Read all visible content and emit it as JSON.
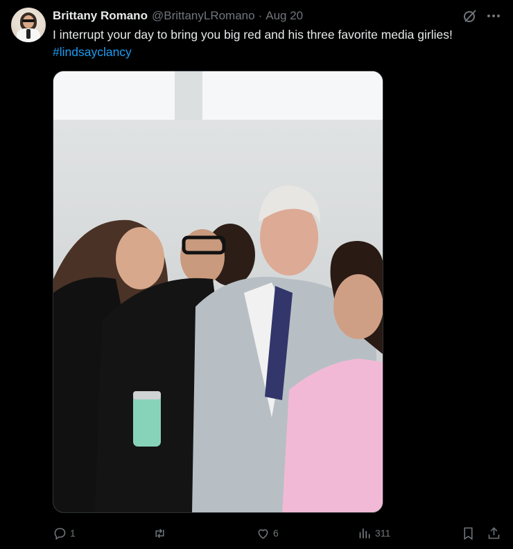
{
  "tweet": {
    "author_name": "Brittany Romano",
    "handle": "@BrittanyLRomano",
    "separator": "·",
    "date": "Aug 20",
    "text": "I interrupt your day to bring you big red and his three favorite media girlies!",
    "hashtag": "#lindsayclancy"
  },
  "actions": {
    "replies": "1",
    "retweets": "",
    "likes": "6",
    "views": "311"
  },
  "icons": {
    "grok": "grok-icon",
    "more": "more-icon",
    "reply": "reply-icon",
    "retweet": "retweet-icon",
    "like": "heart-icon",
    "views": "views-icon",
    "bookmark": "bookmark-icon",
    "share": "share-icon"
  },
  "colors": {
    "background": "#000000",
    "text": "#e7e9ea",
    "muted": "#71767b",
    "link": "#1d9bf0"
  }
}
